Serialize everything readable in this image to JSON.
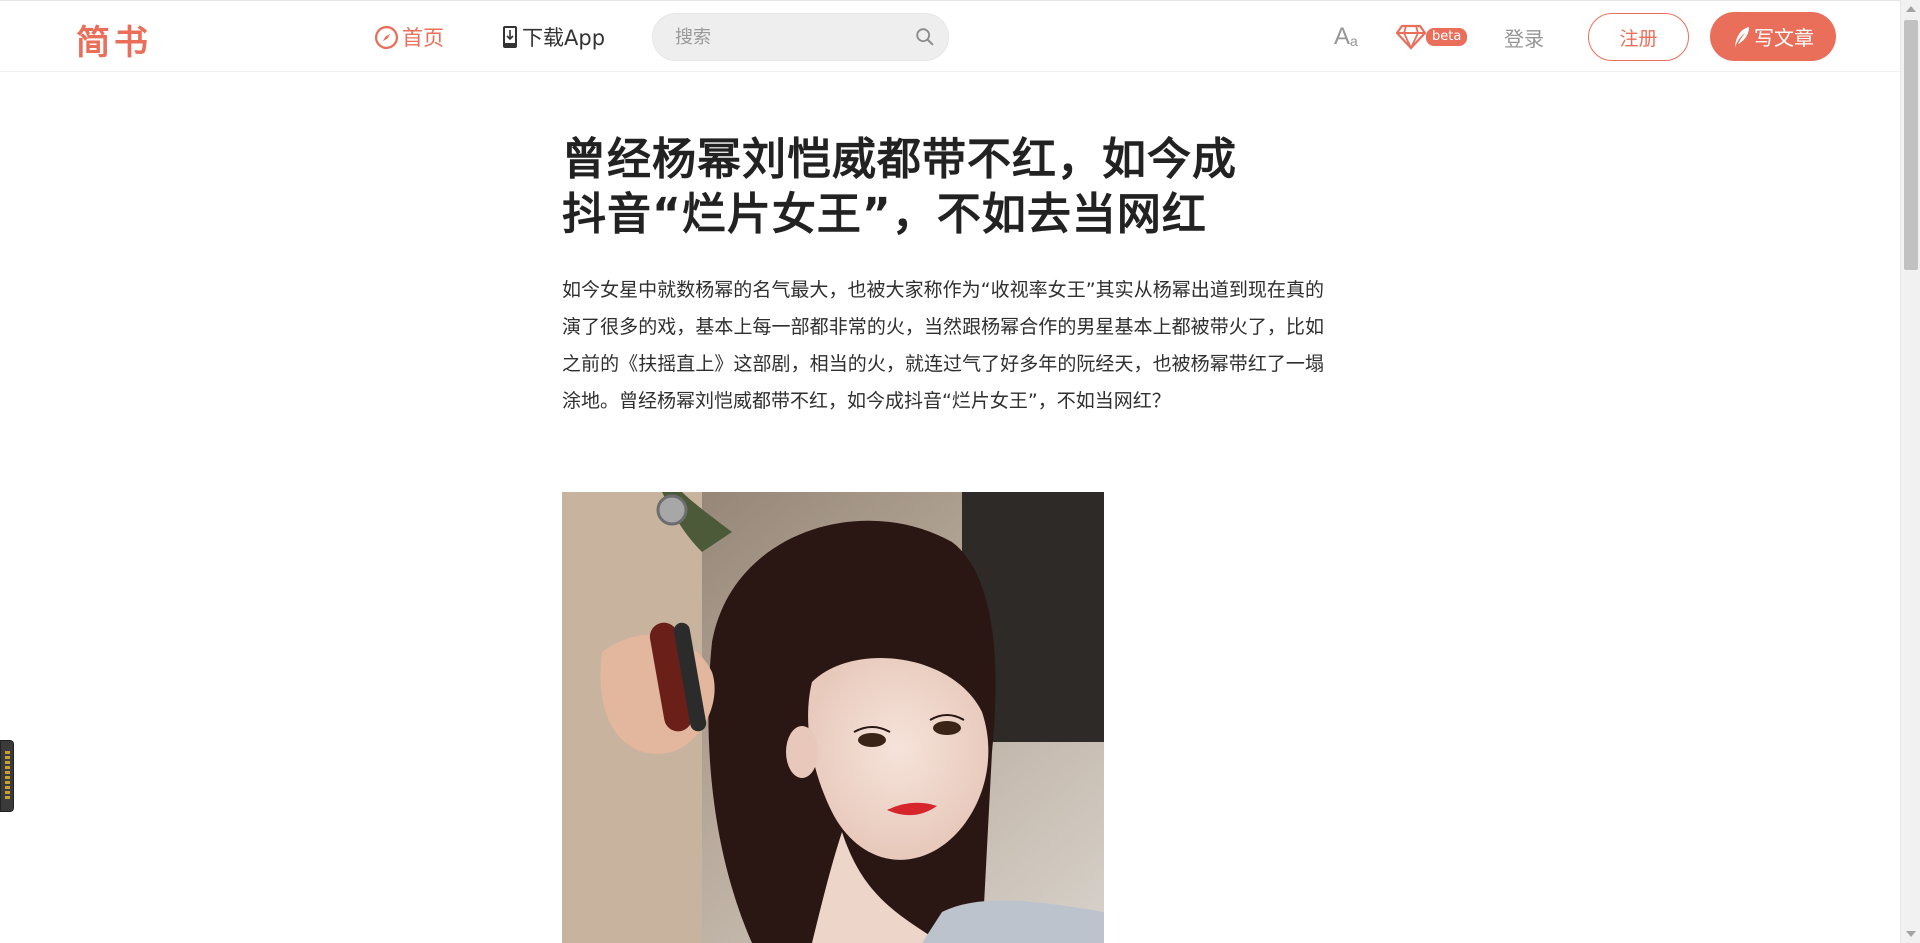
{
  "header": {
    "logo": "简书",
    "nav_home": "首页",
    "nav_download": "下载App",
    "search_placeholder": "搜索",
    "beta_badge": "beta",
    "login": "登录",
    "signup": "注册",
    "write": "写文章"
  },
  "article": {
    "title": "曾经杨幂刘恺威都带不红，如今成抖音“烂片女王”，不如去当网红",
    "body": "如今女星中就数杨幂的名气最大，也被大家称作为“收视率女王”其实从杨幂出道到现在真的演了很多的戏，基本上每一部都非常的火，当然跟杨幂合作的男星基本上都被带火了，比如之前的《扶摇直上》这部剧，相当的火，就连过气了好多年的阮经天，也被杨幂带红了一塌涂地。曾经杨幂刘恺威都带不红，如今成抖音“烂片女王”，不如当网红？"
  },
  "colors": {
    "brand": "#ea6f5a",
    "text": "#333333",
    "muted": "#969696"
  },
  "icons": [
    "compass-icon",
    "phone-download-icon",
    "search-icon",
    "font-size-icon",
    "diamond-icon",
    "feather-icon"
  ]
}
